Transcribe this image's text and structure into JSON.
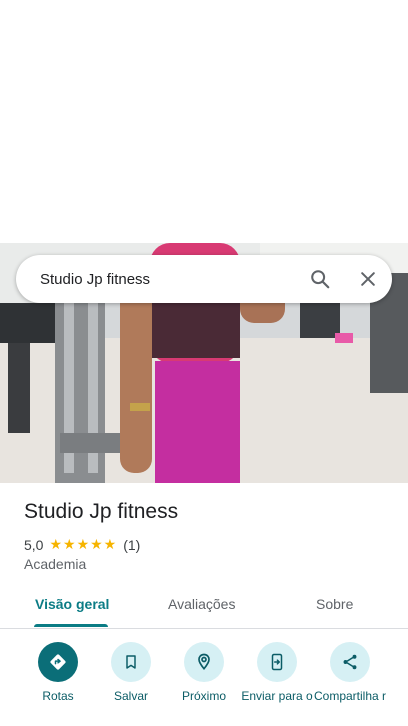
{
  "search": {
    "query": "Studio Jp fitness"
  },
  "place": {
    "name": "Studio Jp fitness",
    "rating": "5,0",
    "stars": "★★★★★",
    "review_count": "(1)",
    "category": "Academia"
  },
  "tabs": [
    {
      "label": "Visão geral"
    },
    {
      "label": "Avaliações"
    },
    {
      "label": "Sobre"
    }
  ],
  "actions": [
    {
      "label": "Rotas",
      "icon": "directions-icon"
    },
    {
      "label": "Salvar",
      "icon": "bookmark-icon"
    },
    {
      "label": "Próximo",
      "icon": "nearby-icon"
    },
    {
      "label": "Enviar para o",
      "icon": "send-to-phone-icon"
    },
    {
      "label": "Compartilha r",
      "icon": "share-icon"
    }
  ],
  "colors": {
    "accent": "#0b7c85",
    "primary_button": "#0b6e78",
    "star": "#f6b400"
  }
}
